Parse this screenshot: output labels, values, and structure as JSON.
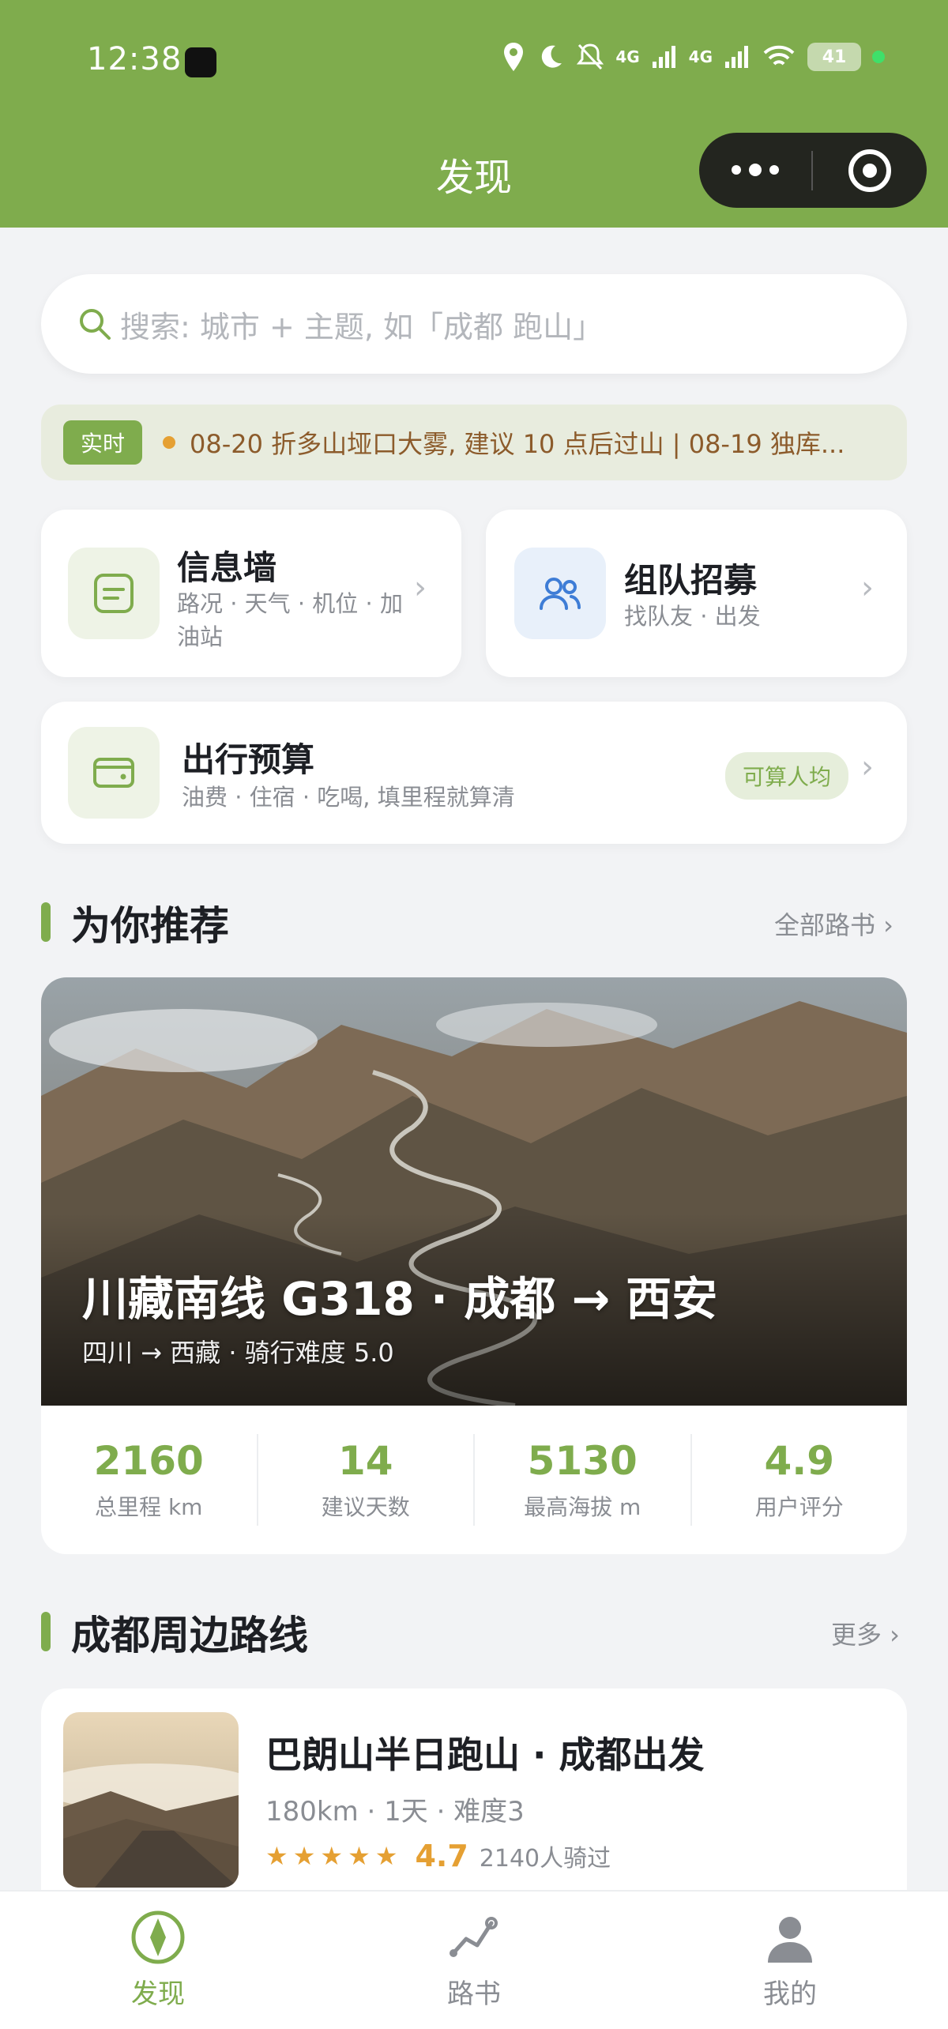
{
  "status_bar": {
    "time": "12:38",
    "battery": "41",
    "net1": "4G",
    "net2": "4G"
  },
  "header": {
    "title": "发现"
  },
  "search": {
    "placeholder": "搜索: 城市 + 主题, 如「成都 跑山」"
  },
  "ticker": {
    "tag": "实时",
    "text": "08-20 折多山垭口大雾, 建议 10 点后过山 | 08-19 独库..."
  },
  "entries": {
    "info_wall": {
      "title": "信息墙",
      "subtitle": "路况 · 天气 · 机位 · 加油站"
    },
    "team": {
      "title": "组队招募",
      "subtitle": "找队友 · 出发"
    },
    "budget": {
      "title": "出行预算",
      "subtitle": "油费 · 住宿 · 吃喝, 填里程就算清",
      "badge": "可算人均"
    }
  },
  "recommend": {
    "title": "为你推荐",
    "more": "全部路书 ›",
    "feature": {
      "title": "川藏南线 G318 · 成都 → 西安",
      "subtitle": "四川 → 西藏 · 骑行难度 5.0",
      "stats": [
        {
          "value": "2160",
          "label": "总里程 km"
        },
        {
          "value": "14",
          "label": "建议天数"
        },
        {
          "value": "5130",
          "label": "最高海拔 m"
        },
        {
          "value": "4.9",
          "label": "用户评分"
        }
      ]
    }
  },
  "nearby": {
    "title": "成都周边路线",
    "more": "更多 ›",
    "routes": [
      {
        "title": "巴朗山半日跑山 · 成都出发",
        "meta": "180km · 1天 · 难度3",
        "stars": "★★★★★",
        "rating": "4.7",
        "riders": "2140人骑过"
      }
    ]
  },
  "tabbar": {
    "items": [
      {
        "label": "发现",
        "icon": "compass-icon",
        "active": true
      },
      {
        "label": "路书",
        "icon": "route-icon",
        "active": false
      },
      {
        "label": "我的",
        "icon": "user-icon",
        "active": false
      }
    ]
  },
  "colors": {
    "brand": "#7fac4d",
    "accent": "#e5a033",
    "background": "#f2f3f5"
  }
}
